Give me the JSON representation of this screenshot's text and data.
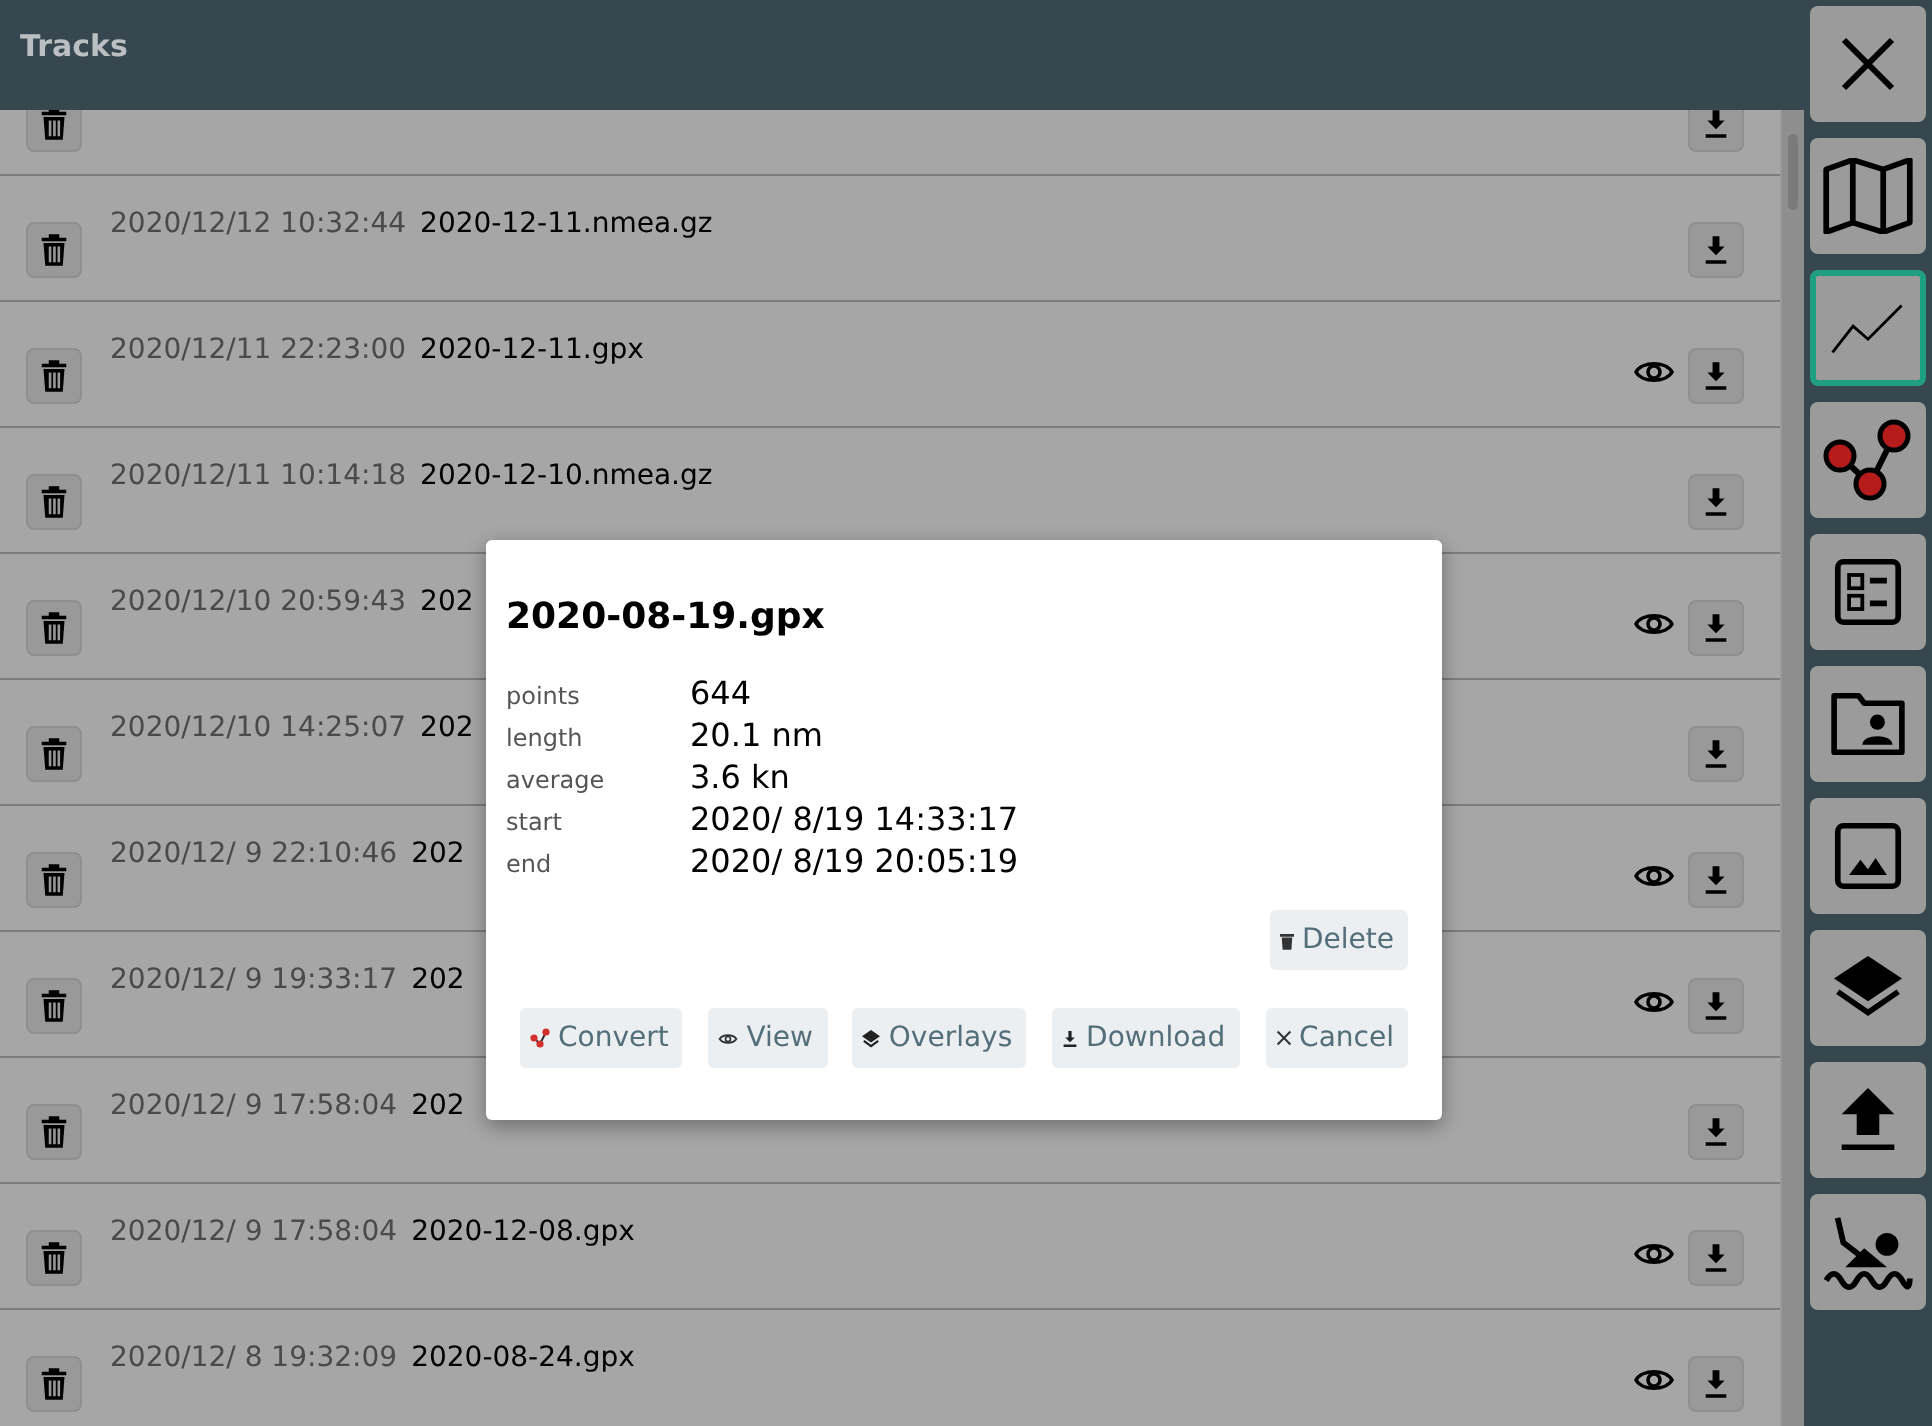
{
  "header": {
    "title": "Tracks"
  },
  "tracks": [
    {
      "viewable": false
    },
    {
      "date": "2020/12/12 10:32:44",
      "name": "2020-12-11.nmea.gz",
      "viewable": false
    },
    {
      "date": "2020/12/11 22:23:00",
      "name": "2020-12-11.gpx",
      "viewable": true
    },
    {
      "date": "2020/12/11 10:14:18",
      "name": "2020-12-10.nmea.gz",
      "viewable": false
    },
    {
      "date": "2020/12/10 20:59:43",
      "name": "202",
      "viewable": true
    },
    {
      "date": "2020/12/10 14:25:07",
      "name": "202",
      "viewable": false
    },
    {
      "date": "2020/12/ 9 22:10:46",
      "name": "202",
      "viewable": true
    },
    {
      "date": "2020/12/ 9 19:33:17",
      "name": "202",
      "viewable": true
    },
    {
      "date": "2020/12/ 9 17:58:04",
      "name": "202",
      "viewable": false
    },
    {
      "date": "2020/12/ 9 17:58:04",
      "name": "2020-12-08.gpx",
      "viewable": true
    },
    {
      "date": "2020/12/ 8 19:32:09",
      "name": "2020-08-24.gpx",
      "viewable": true
    }
  ],
  "sidebar": [
    {
      "kind": "close",
      "selected": false
    },
    {
      "kind": "map",
      "selected": false
    },
    {
      "kind": "chart",
      "selected": true
    },
    {
      "kind": "nodes",
      "selected": false
    },
    {
      "kind": "list",
      "selected": false
    },
    {
      "kind": "folder",
      "selected": false
    },
    {
      "kind": "image",
      "selected": false
    },
    {
      "kind": "layers",
      "selected": false
    },
    {
      "kind": "upload",
      "selected": false
    },
    {
      "kind": "swimmer",
      "selected": false
    }
  ],
  "dialog": {
    "title": "2020-08-19.gpx",
    "info": [
      {
        "label": "points",
        "value": "644"
      },
      {
        "label": "length",
        "value": "20.1 nm"
      },
      {
        "label": "average",
        "value": "3.6 kn"
      },
      {
        "label": "start",
        "value": "2020/ 8/19 14:33:17"
      },
      {
        "label": "end",
        "value": "2020/ 8/19 20:05:19"
      }
    ],
    "delete_button": "Delete",
    "buttons": [
      {
        "kind": "convert",
        "label": "Convert"
      },
      {
        "kind": "view",
        "label": "View"
      },
      {
        "kind": "overlays",
        "label": "Overlays"
      },
      {
        "kind": "download",
        "label": "Download"
      },
      {
        "kind": "cancel",
        "label": "Cancel"
      }
    ]
  }
}
